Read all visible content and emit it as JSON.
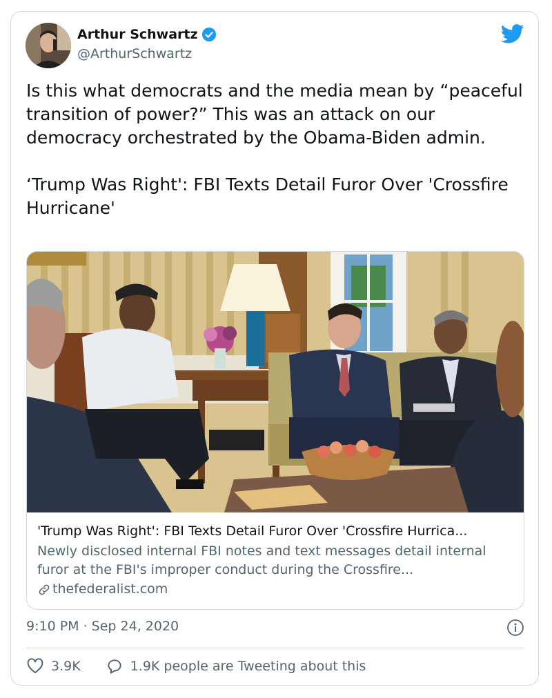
{
  "tweet": {
    "author": {
      "display_name": "Arthur Schwartz",
      "handle": "@ArthurSchwartz",
      "verified": true,
      "avatar_icon": "avatar"
    },
    "platform_icon": "twitter-bird-icon",
    "text": "Is this what democrats and the media mean by “peaceful transition of power?” This was an attack on our democracy orchestrated by the Obama-Biden admin.\n\n‘Trump Was Right': FBI Texts Detail Furor Over 'Crossfire Hurricane'",
    "link_card": {
      "title": "'Trump Was Right': FBI Texts Detail Furor Over 'Crossfire Hurrica...",
      "description": "Newly disclosed internal FBI notes and text messages detail internal furor at the FBI's improper conduct during the Crossfire...",
      "domain": "thefederalist.com",
      "domain_icon": "link-icon",
      "image_icon": "article-photo"
    },
    "timestamp": "9:10 PM · Sep 24, 2020",
    "info_icon": "info-icon",
    "likes": "3.9K",
    "replies_text": "1.9K people are Tweeting about this"
  },
  "colors": {
    "accent": "#1d9bf0",
    "text_primary": "#0f1419",
    "text_secondary": "#536471",
    "border": "#cfd9de"
  }
}
